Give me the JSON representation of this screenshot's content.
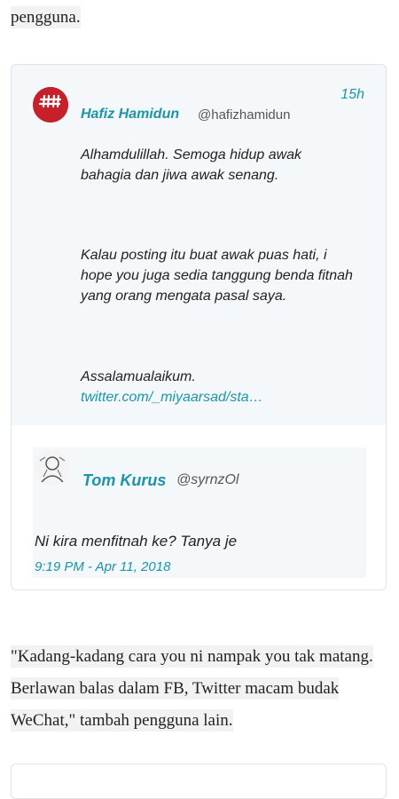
{
  "article": {
    "para_top": "pengguna.",
    "para_bottom_lines": [
      "\"Kadang-kadang cara you ni nampak you tak matang.",
      "Berlawan balas dalam FB, Twitter macam budak",
      "WeChat,\" tambah pengguna lain."
    ]
  },
  "tweet": {
    "author_name": "Hafiz Hamidun",
    "author_handle": "@hafizhamidun",
    "time": "15h",
    "paragraphs": [
      "Alhamdulillah. Semoga hidup awak bahagia dan jiwa awak senang.",
      "Kalau posting itu buat awak puas hati, i hope you juga sedia tanggung benda fitnah yang orang mengata pasal saya.",
      "Assalamualaikum."
    ],
    "link": "twitter.com/_miyaarsad/sta…",
    "avatar_icon": "hafiz-logo-icon",
    "brand_red": "#c8202a"
  },
  "quoted": {
    "author_name": "Tom Kurus",
    "author_handle": "@syrnzOl",
    "text": "Ni kira menfitnah ke? Tanya je",
    "date": "9:19 PM - Apr 11, 2018",
    "avatar_icon": "tom-kurus-avatar-icon"
  },
  "colors": {
    "link": "#1b95a8",
    "card_bg": "#f5f8fa",
    "border": "#dfe4e8"
  }
}
